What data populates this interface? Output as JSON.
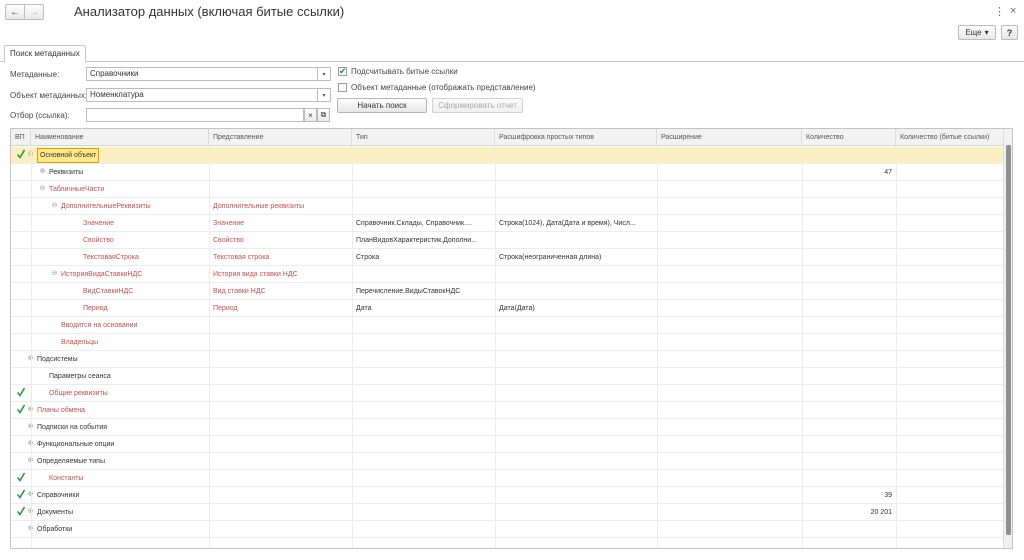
{
  "window": {
    "title": "Анализатор данных (включая битые ссылки)",
    "back_glyph": "←",
    "forward_glyph": "→",
    "menu_glyph": "⋮",
    "close_glyph": "×"
  },
  "toolbar": {
    "more_label": "Еще",
    "more_arrow": "▾",
    "help_label": "?"
  },
  "tabs": [
    {
      "label": "Поиск метаданных"
    }
  ],
  "form": {
    "metadata_label": "Метаданные:",
    "metadata_value": "Справочники",
    "metaobject_label": "Объект метаданных:",
    "metaobject_value": "Номенклатура",
    "filter_label": "Отбор (ссылка):",
    "filter_value": "",
    "dropdown_arrow": "▾",
    "clear_glyph": "×",
    "open_glyph": "⧉",
    "count_broken_label": "Подсчитывать битые ссылки",
    "count_broken_checked": true,
    "show_presentation_label": "Объект метаданные (отображать представление)",
    "show_presentation_checked": false,
    "check_glyph": "✔",
    "start_button": "Начать поиск",
    "report_button": "Сформировать отчет"
  },
  "grid": {
    "columns": [
      "ВП",
      "Наименование",
      "Представление",
      "Тип",
      "Расшифровка простых типов",
      "Расширение",
      "Количество",
      "Количество (битые ссылки)"
    ],
    "expand_glyph": "⊕",
    "collapse_glyph": "⊖",
    "rows": [
      {
        "vp": true,
        "name": "Основной объект",
        "pres": "",
        "type": "",
        "decode": "",
        "ext": "",
        "count": "",
        "broken": ""
      },
      {
        "vp": false,
        "name": "Реквизиты",
        "pres": "",
        "type": "",
        "decode": "",
        "ext": "",
        "count": "47",
        "broken": ""
      },
      {
        "vp": false,
        "name": "ТабличныеЧасти",
        "pres": "",
        "type": "",
        "decode": "",
        "ext": "",
        "count": "",
        "broken": ""
      },
      {
        "vp": false,
        "name": "ДополнительныеРеквизиты",
        "pres": "Дополнительные реквизиты",
        "type": "",
        "decode": "",
        "ext": "",
        "count": "",
        "broken": ""
      },
      {
        "vp": false,
        "name": "Значение",
        "pres": "Значение",
        "type": "Справочник.Склады, Справочник....",
        "decode": "Строка(1024), Дата(Дата и время), Числ...",
        "ext": "",
        "count": "",
        "broken": ""
      },
      {
        "vp": false,
        "name": "Свойство",
        "pres": "Свойство",
        "type": "ПланВидовХарактеристик.Дополни...",
        "decode": "",
        "ext": "",
        "count": "",
        "broken": ""
      },
      {
        "vp": false,
        "name": "ТекстоваяСтрока",
        "pres": "Текстовая строка",
        "type": "Строка",
        "decode": "Строка(неограниченная длина)",
        "ext": "",
        "count": "",
        "broken": ""
      },
      {
        "vp": false,
        "name": "ИсторияВидаСтавкиНДС",
        "pres": "История вида ставки НДС",
        "type": "",
        "decode": "",
        "ext": "",
        "count": "",
        "broken": ""
      },
      {
        "vp": false,
        "name": "ВидСтавкиНДС",
        "pres": "Вид ставки НДС",
        "type": "Перечисление.ВидыСтавокНДС",
        "decode": "",
        "ext": "",
        "count": "",
        "broken": ""
      },
      {
        "vp": false,
        "name": "Период",
        "pres": "Период",
        "type": "Дата",
        "decode": "Дата(Дата)",
        "ext": "",
        "count": "",
        "broken": ""
      },
      {
        "vp": false,
        "name": "Вводится на основании",
        "pres": "",
        "type": "",
        "decode": "",
        "ext": "",
        "count": "",
        "broken": ""
      },
      {
        "vp": false,
        "name": "Владельцы",
        "pres": "",
        "type": "",
        "decode": "",
        "ext": "",
        "count": "",
        "broken": ""
      },
      {
        "vp": false,
        "name": "Подсистемы",
        "pres": "",
        "type": "",
        "decode": "",
        "ext": "",
        "count": "",
        "broken": ""
      },
      {
        "vp": false,
        "name": "Параметры сеанса",
        "pres": "",
        "type": "",
        "decode": "",
        "ext": "",
        "count": "",
        "broken": ""
      },
      {
        "vp": true,
        "name": "Общие реквизиты",
        "pres": "",
        "type": "",
        "decode": "",
        "ext": "",
        "count": "",
        "broken": ""
      },
      {
        "vp": true,
        "name": "Планы обмена",
        "pres": "",
        "type": "",
        "decode": "",
        "ext": "",
        "count": "",
        "broken": ""
      },
      {
        "vp": false,
        "name": "Подписки на события",
        "pres": "",
        "type": "",
        "decode": "",
        "ext": "",
        "count": "",
        "broken": ""
      },
      {
        "vp": false,
        "name": "Функциональные опции",
        "pres": "",
        "type": "",
        "decode": "",
        "ext": "",
        "count": "",
        "broken": ""
      },
      {
        "vp": false,
        "name": "Определяемые типы",
        "pres": "",
        "type": "",
        "decode": "",
        "ext": "",
        "count": "",
        "broken": ""
      },
      {
        "vp": true,
        "name": "Константы",
        "pres": "",
        "type": "",
        "decode": "",
        "ext": "",
        "count": "",
        "broken": ""
      },
      {
        "vp": true,
        "name": "Справочники",
        "pres": "",
        "type": "",
        "decode": "",
        "ext": "",
        "count": "39",
        "broken": ""
      },
      {
        "vp": true,
        "name": "Документы",
        "pres": "",
        "type": "",
        "decode": "",
        "ext": "",
        "count": "20 201",
        "broken": ""
      },
      {
        "vp": false,
        "name": "Обработки",
        "pres": "",
        "type": "",
        "decode": "",
        "ext": "",
        "count": "",
        "broken": ""
      }
    ]
  },
  "colors": {
    "red_text": "#c0504d",
    "check_green": "#2a9a3a",
    "selection_bg": "#fbefc1"
  }
}
